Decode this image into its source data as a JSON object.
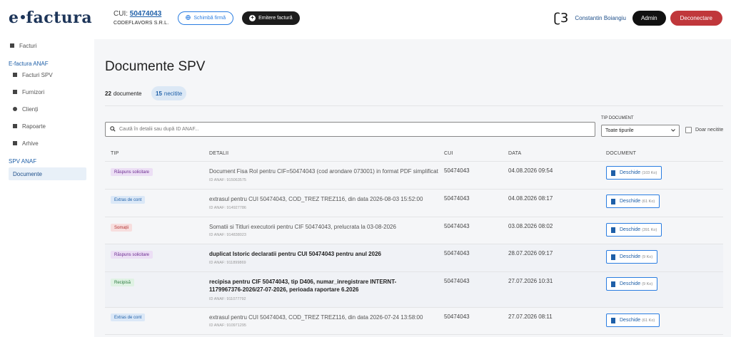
{
  "header": {
    "logo_e": "e",
    "logo_rest": "factura",
    "cui_label": "CUI:",
    "cui_value": "50474043",
    "company": "CODEFLAVORS S.R.L.",
    "schimba_label": "Schimbă firmă",
    "emitere_label": "Emitere factură",
    "user_logo": "ʗ3",
    "user_name": "Constantin Boiangiu",
    "admin_label": "Admin",
    "logout_label": "Deconectare"
  },
  "sidebar": {
    "facturi": "Facturi",
    "group_anaf": "E-factura ANAF",
    "facturi_spv": "Facturi SPV",
    "furnizori": "Furnizori",
    "clienti": "Clienți",
    "rapoarte": "Rapoarte",
    "arhive": "Arhive",
    "group_spv": "SPV ANAF",
    "documente": "Documente"
  },
  "main": {
    "title": "Documente SPV",
    "count_num": "22",
    "count_label": "documente",
    "unread_num": "15",
    "unread_label": "necitite",
    "search_placeholder": "Caută în detalii sau după ID ANAF...",
    "tip_label": "TIP DOCUMENT",
    "tip_value": "Toate tipurile",
    "only_unread": "Doar necitite",
    "col_tip": "TIP",
    "col_detalii": "DETALII",
    "col_cui": "CUI",
    "col_data": "DATA",
    "col_document": "DOCUMENT",
    "open_label": "Deschide"
  },
  "rows": [
    {
      "tip": "Răspuns solicitare",
      "detalii": "Document Fisa Rol pentru CIF=50474043 (cod arondare 073001) in format PDF simplificat",
      "anaf": "ID ANAF: 915063575",
      "cui": "50474043",
      "data": "04.08.2026 09:54",
      "size": "(103 Ko)"
    },
    {
      "tip": "Extras de cont",
      "detalii": "extrasul pentru CUI 50474043, COD_TREZ TREZ116, din data 2026-08-03 15:52:00",
      "anaf": "ID ANAF: 914927786",
      "cui": "50474043",
      "data": "04.08.2026 08:17",
      "size": "(61 Ko)"
    },
    {
      "tip": "Somații",
      "detalii": "Somatii si Titluri executorii pentru CIF 50474043, prelucrata la 03-08-2026",
      "anaf": "ID ANAF: 914838023",
      "cui": "50474043",
      "data": "03.08.2026 08:02",
      "size": "(391 Ko)"
    },
    {
      "tip": "Răspuns solicitare",
      "detalii": "duplicat Istoric declaratii pentru CUI 50474043 pentru anul 2026",
      "anaf": "ID ANAF: 911899869",
      "cui": "50474043",
      "data": "28.07.2026 09:17",
      "size": "(9 Ko)"
    },
    {
      "tip": "Recipisă",
      "detalii": "recipisa pentru CIF 50474043, tip D406, numar_inregistrare INTERNT-1179967376-2026/27-07-2026, perioada raportare 6.2026",
      "anaf": "ID ANAF: 911077792",
      "cui": "50474043",
      "data": "27.07.2026 10:31",
      "size": "(9 Ko)"
    },
    {
      "tip": "Extras de cont",
      "detalii": "extrasul pentru CUI 50474043, COD_TREZ TREZ116, din data 2026-07-24 13:58:00",
      "anaf": "ID ANAF: 910971295",
      "cui": "50474043",
      "data": "27.07.2026 08:11",
      "size": "(61 Ko)"
    }
  ]
}
